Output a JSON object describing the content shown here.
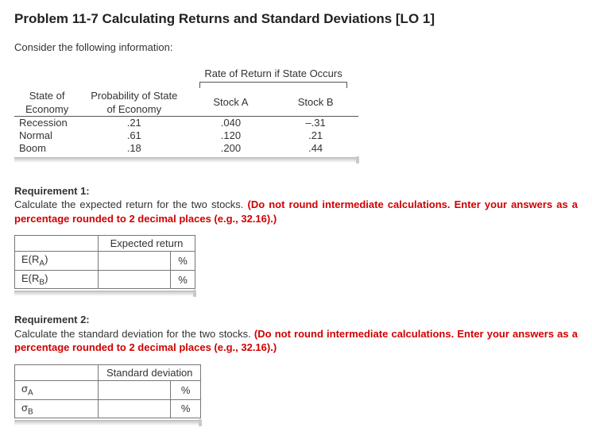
{
  "title": "Problem 11-7 Calculating Returns and Standard Deviations [LO 1]",
  "intro": "Consider the following information:",
  "table": {
    "group_header": "Rate of Return if State Occurs",
    "headers": {
      "state": "State of Economy",
      "prob": "Probability of State of Economy",
      "stockA": "Stock A",
      "stockB": "Stock B"
    },
    "rows": [
      {
        "state": "Recession",
        "prob": ".21",
        "a": ".040",
        "b": "–.31"
      },
      {
        "state": "Normal",
        "prob": ".61",
        "a": ".120",
        "b": ".21"
      },
      {
        "state": "Boom",
        "prob": ".18",
        "a": ".200",
        "b": ".44"
      }
    ]
  },
  "req1": {
    "title": "Requirement 1:",
    "text": "Calculate the expected return for the two stocks. ",
    "note": "(Do not round intermediate calculations. Enter your answers as a percentage rounded to 2 decimal places (e.g., 32.16).)",
    "answer_header": "Expected return",
    "rows": [
      {
        "label_main": "E(R",
        "label_sub": "A",
        "label_tail": ")",
        "unit": "%"
      },
      {
        "label_main": "E(R",
        "label_sub": "B",
        "label_tail": ")",
        "unit": "%"
      }
    ]
  },
  "req2": {
    "title": "Requirement 2:",
    "text": "Calculate the standard deviation for the two stocks. ",
    "note": "(Do not round intermediate calculations. Enter your answers as a percentage rounded to 2 decimal places (e.g., 32.16).)",
    "answer_header": "Standard deviation",
    "rows": [
      {
        "label_main": "σ",
        "label_sub": "A",
        "label_tail": "",
        "unit": "%"
      },
      {
        "label_main": "σ",
        "label_sub": "B",
        "label_tail": "",
        "unit": "%"
      }
    ]
  }
}
